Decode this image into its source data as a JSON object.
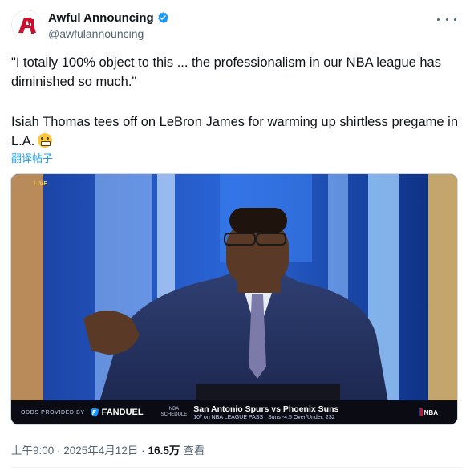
{
  "author": {
    "display_name": "Awful Announcing",
    "handle": "@awfulannouncing",
    "avatar": "aa-logo-icon",
    "verified_icon": "verified-badge-icon"
  },
  "tweet": {
    "quote": "\"I totally 100% object to this ... the professionalism in our NBA league has diminished so much.\"",
    "body": "Isiah Thomas tees off on LeBron James for warming up shirtless pregame in L.A.",
    "emoji": "grimacing-face-icon",
    "translate_label": "翻译帖子"
  },
  "media": {
    "live_label": "LIVE",
    "ticker": {
      "odds_label": "ODDS PROVIDED BY",
      "sponsor": "FANDUEL",
      "schedule_label_1": "NBA",
      "schedule_label_2": "SCHEDULE",
      "matchup": "San Antonio Spurs vs Phoenix Suns",
      "time_network": "10ᴾ on NBA LEAGUE PASS",
      "line": "Suns -4.5   Over/Under: 232",
      "league_logo": "NBA"
    }
  },
  "meta": {
    "timestamp": "上午9:00 · 2025年4月12日 · ",
    "views": "16.5万",
    "views_label": "查看"
  },
  "colors": {
    "accent": "#1d9bf0",
    "text_primary": "#0f1419",
    "text_secondary": "#536471",
    "brand_red": "#c8102e"
  }
}
